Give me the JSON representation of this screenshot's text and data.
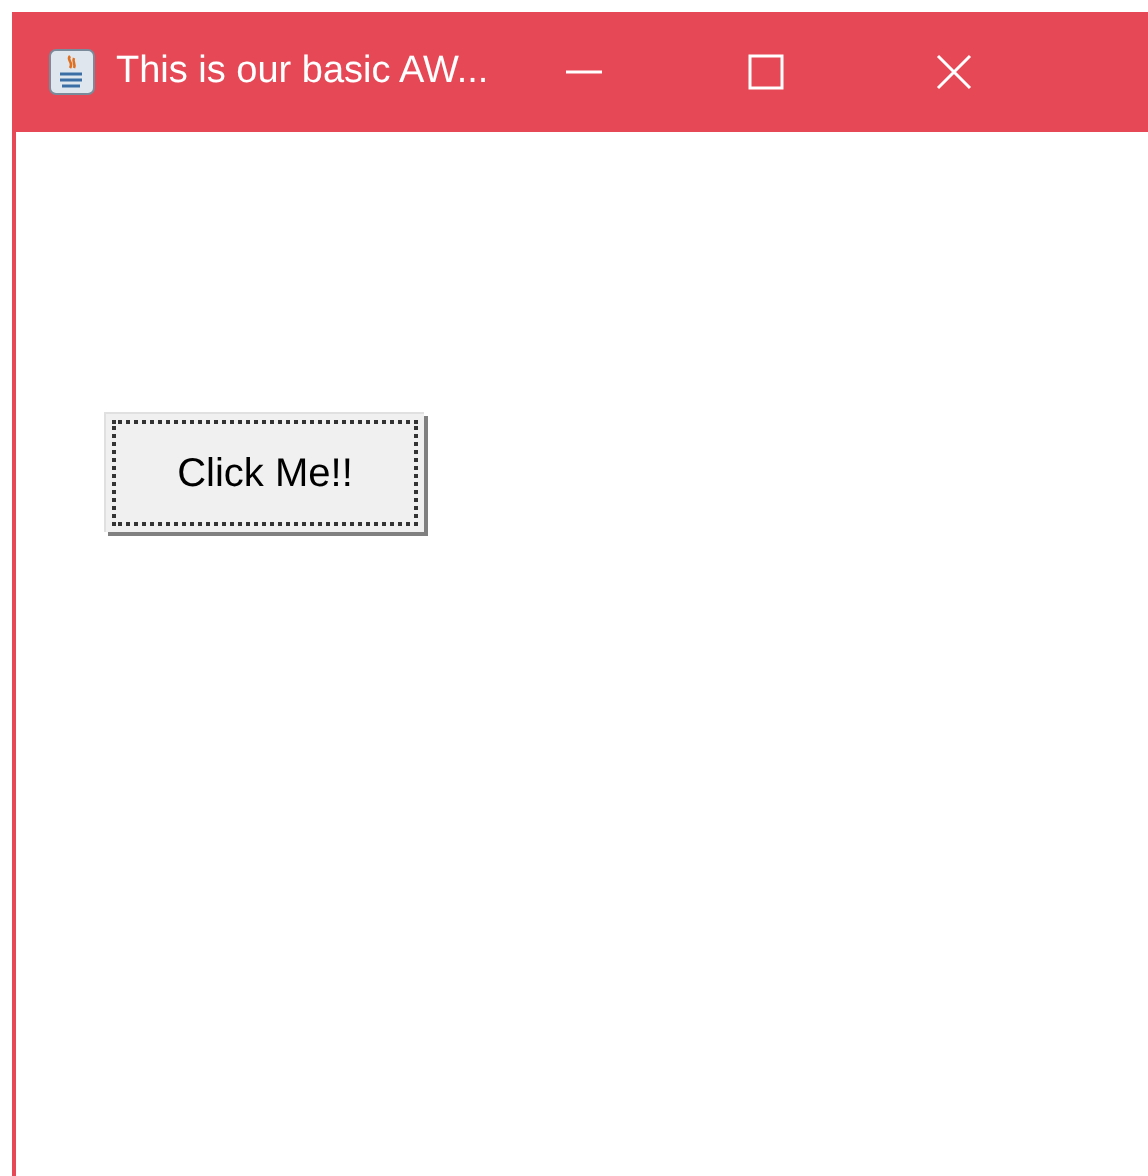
{
  "window": {
    "title": "This is our basic AW..."
  },
  "button": {
    "label": "Click Me!!",
    "focused": true
  }
}
